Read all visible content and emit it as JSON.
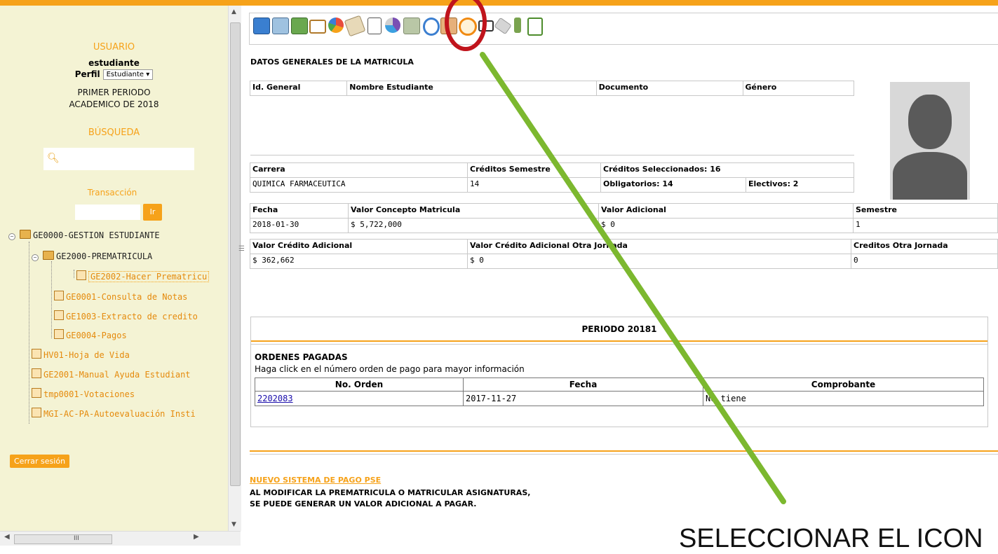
{
  "sidebar": {
    "usuario_label": "USUARIO",
    "user_name": "estudiante",
    "perfil_label": "Perfil",
    "perfil_value": "Estudiante",
    "period_line1": "PRIMER PERIODO",
    "period_line2": "ACADEMICO DE 2018",
    "busqueda_label": "BÚSQUEDA",
    "transaccion_label": "Transacción",
    "ir_label": "Ir",
    "tree": [
      "GE0000-GESTION ESTUDIANTE",
      "GE2000-PREMATRICULA",
      "GE2002-Hacer Prematricu",
      "GE0001-Consulta de Notas",
      "GE1003-Extracto de credito",
      "GE0004-Pagos",
      "HV01-Hoja de Vida",
      "GE2001-Manual Ayuda Estudiant",
      "tmp0001-Votaciones",
      "MGI-AC-PA-Autoevaluación Insti"
    ],
    "logout_label": "Cerrar sesión",
    "scroll_grip": "III"
  },
  "main": {
    "title": "DATOS GENERALES DE LA MATRICULA",
    "head": {
      "id_general": "Id. General",
      "nombre": "Nombre Estudiante",
      "documento": "Documento",
      "genero": "Género"
    },
    "carrera_label": "Carrera",
    "creditos_semestre_label": "Créditos Semestre",
    "creditos_sel_label": "Créditos Seleccionados: 16",
    "carrera_value": "QUIMICA FARMACEUTICA",
    "creditos_semestre_value": "14",
    "obligatorios": "Obligatorios: 14",
    "electivos": "Electivos: 2",
    "fecha_label": "Fecha",
    "valor_concepto_label": "Valor Concepto Matricula",
    "valor_adicional_label": "Valor Adicional",
    "semestre_label": "Semestre",
    "fecha_value": "2018-01-30",
    "valor_concepto_value": "$ 5,722,000",
    "valor_adicional_value": "$ 0",
    "semestre_value": "1",
    "valor_credito_adicional_label": "Valor Crédito Adicional",
    "valor_credito_otra_label": "Valor Crédito Adicional Otra Jornada",
    "creditos_otra_label": "Creditos Otra Jornada",
    "valor_credito_adicional_value": "$ 362,662",
    "valor_credito_otra_value": "$ 0",
    "creditos_otra_value": "0",
    "periodo_title": "PERIODO 20181",
    "ordenes_title": "ORDENES PAGADAS",
    "ordenes_hint": "Haga click en el número orden de pago para mayor información",
    "ordenes_headers": [
      "No. Orden",
      "Fecha",
      "Comprobante"
    ],
    "ordenes_row": [
      "2202083",
      "2017-11-27",
      "No tiene"
    ],
    "pse_link": "NUEVO SISTEMA DE PAGO PSE",
    "note_line1": "AL MODIFICAR LA PREMATRICULA O MATRICULAR ASIGNATURAS,",
    "note_line2": "SE PUEDE GENERAR UN VALOR ADICIONAL A PAGAR."
  },
  "toolbar_icons": [
    "search-doc-icon",
    "calculator-icon",
    "money-hand-icon",
    "envelope-icon",
    "pie-chart-icon",
    "newspaper-icon",
    "text-doc-icon",
    "pie-3d-icon",
    "hand-pay-icon",
    "clock-blue-icon",
    "hand-money-icon",
    "clock-orange-icon",
    "book-icon",
    "eraser-icon",
    "person-tool-icon",
    "exit-door-icon"
  ],
  "annotation": {
    "instruction": "SELECCIONAR EL ICON",
    "highlight_color": "#c0141c",
    "arrow_color": "#7cb82f"
  },
  "colors": {
    "accent": "#f6a21a",
    "sidebar_bg": "#f4f3d4"
  }
}
